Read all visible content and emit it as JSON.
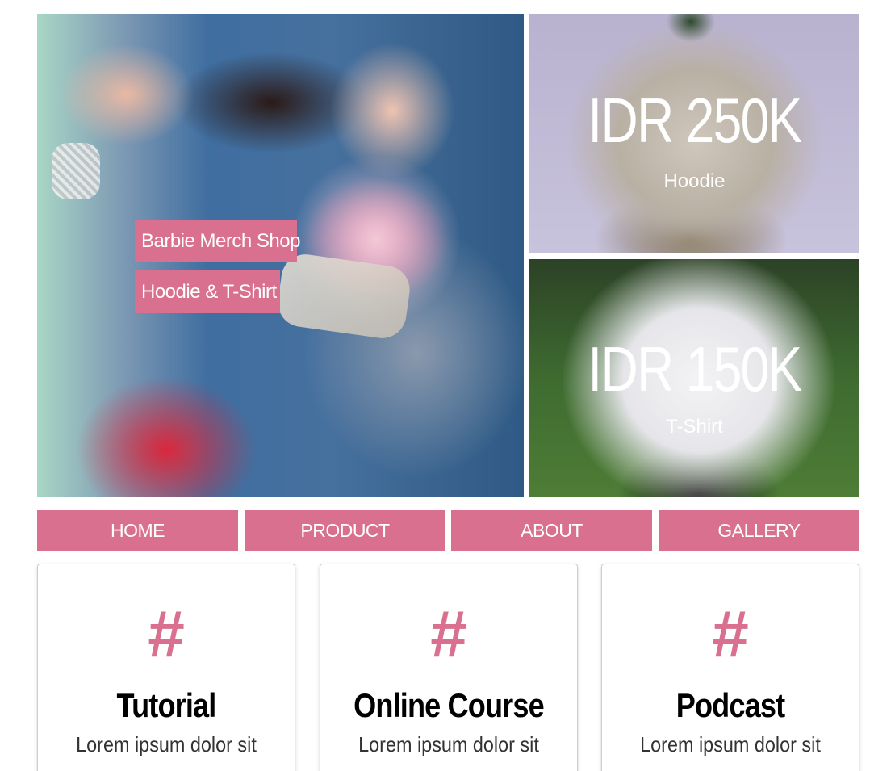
{
  "hero": {
    "tag_1": "Barbie Merch Shop",
    "tag_2": "Hoodie & T-Shirt"
  },
  "products": [
    {
      "price": "IDR 250K",
      "type": "Hoodie"
    },
    {
      "price": "IDR 150K",
      "type": "T-Shirt"
    }
  ],
  "nav": {
    "items": [
      {
        "label": "HOME"
      },
      {
        "label": "PRODUCT"
      },
      {
        "label": "ABOUT"
      },
      {
        "label": "GALLERY"
      }
    ]
  },
  "cards": [
    {
      "icon": "#",
      "title": "Tutorial",
      "text": "Lorem ipsum dolor sit"
    },
    {
      "icon": "#",
      "title": "Online Course",
      "text": "Lorem ipsum dolor sit"
    },
    {
      "icon": "#",
      "title": "Podcast",
      "text": "Lorem ipsum dolor sit"
    }
  ],
  "colors": {
    "accent": "#d9708f",
    "text_dark": "#000000"
  },
  "icons": {
    "card_icon": "hashtag-icon"
  }
}
